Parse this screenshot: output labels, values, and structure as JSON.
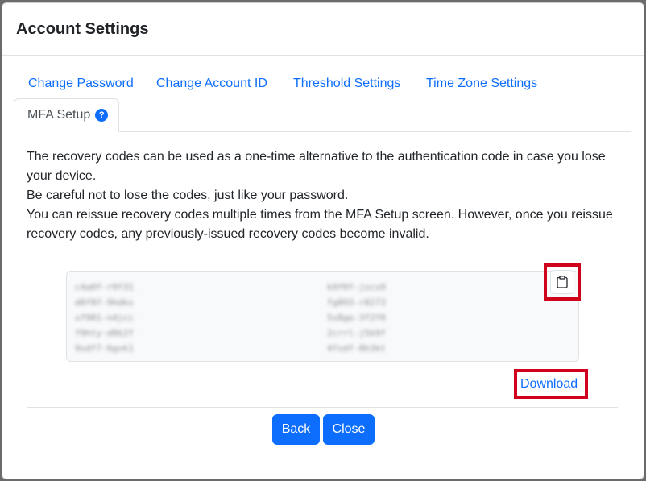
{
  "modal": {
    "title": "Account Settings"
  },
  "tabs": [
    {
      "label": "Change Password"
    },
    {
      "label": "Change Account ID"
    },
    {
      "label": "Threshold Settings"
    },
    {
      "label": "Time Zone Settings"
    },
    {
      "label": "MFA Setup",
      "active": true
    }
  ],
  "help_icon": {
    "glyph": "?"
  },
  "description": [
    "The recovery codes can be used as a one-time alternative to the authentication code in case you lose your device.",
    "Be careful not to lose the codes, just like your password.",
    "You can reissue recovery codes multiple times from the MFA Setup screen. However, once you reissue recovery codes, any previously-issued recovery codes become invalid."
  ],
  "recovery_codes": {
    "left": [
      "c4a0f-r9f31",
      "d0f8f-9hdks",
      "xf981-n4jcc",
      "f9hty-d8k2f",
      "9sdf7-6gvk1"
    ],
    "right": [
      "k9f0f-jscx9",
      "fg893-r8273",
      "5s8ge-3f2f0",
      "2crrl-j5k9f",
      "4fsdf-8h3kt"
    ]
  },
  "actions": {
    "download_label": "Download",
    "back_label": "Back",
    "close_label": "Close"
  },
  "colors": {
    "accent": "#0d6efd",
    "highlight": "#d0021b"
  }
}
